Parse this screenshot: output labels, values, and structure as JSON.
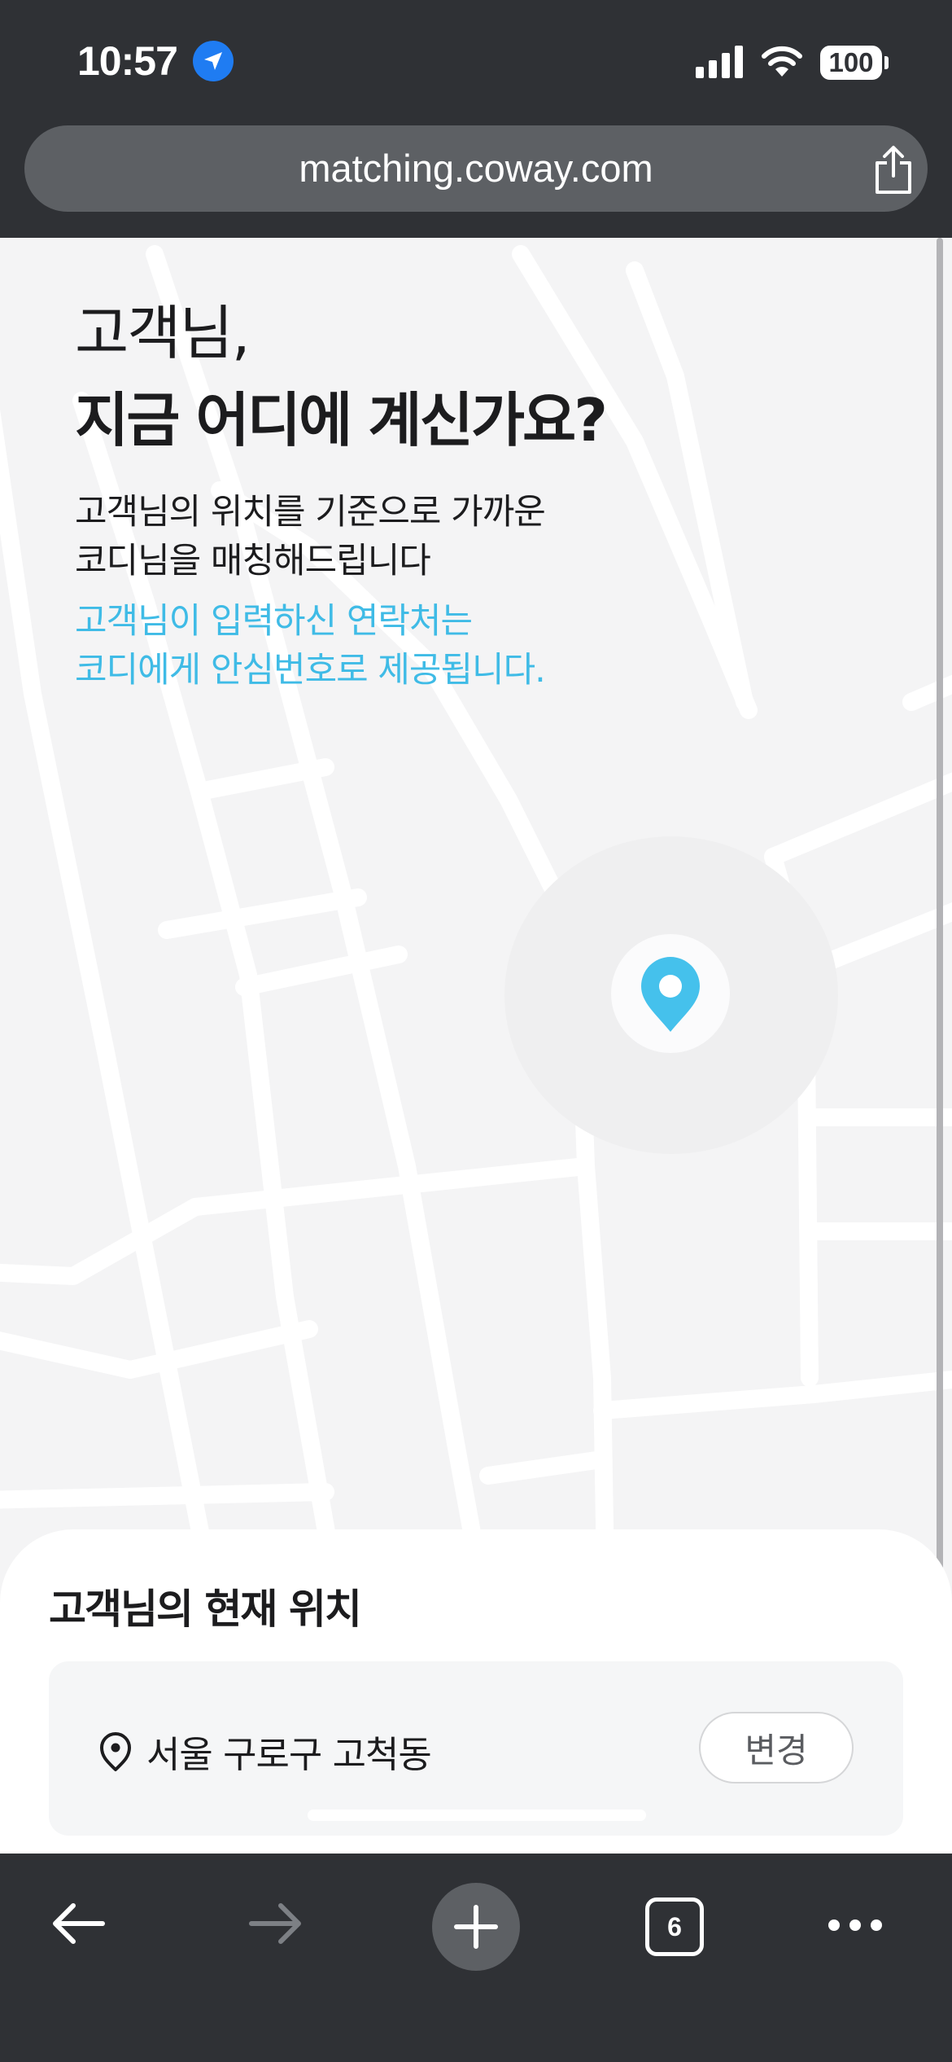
{
  "status_bar": {
    "time": "10:57",
    "battery": "100",
    "icons": [
      "location-arrow-icon",
      "cellular-signal-icon",
      "wifi-icon",
      "battery-icon"
    ]
  },
  "browser": {
    "url": "matching.coway.com",
    "share_icon": "share-icon"
  },
  "page": {
    "heading_line1": "고객님,",
    "heading_line2": "지금 어디에 계신가요?",
    "desc_line1": "고객님의 위치를 기준으로 가까운",
    "desc_line2": "코디님을 매칭해드립니다",
    "notice_line1": "고객님이 입력하신 연락처는",
    "notice_line2": "코디에게 안심번호로 제공됩니다."
  },
  "sheet": {
    "title": "고객님의 현재 위치",
    "location": "서울 구로구 고척동",
    "change_label": "변경"
  },
  "toolbar": {
    "tab_count": "6",
    "icons": [
      "back-arrow-icon",
      "forward-arrow-icon",
      "plus-icon",
      "tabs-icon",
      "more-icon"
    ]
  },
  "colors": {
    "accent_blue": "#3fbbe6",
    "chrome_dark": "#2f3135",
    "map_background": "#f4f4f5"
  }
}
